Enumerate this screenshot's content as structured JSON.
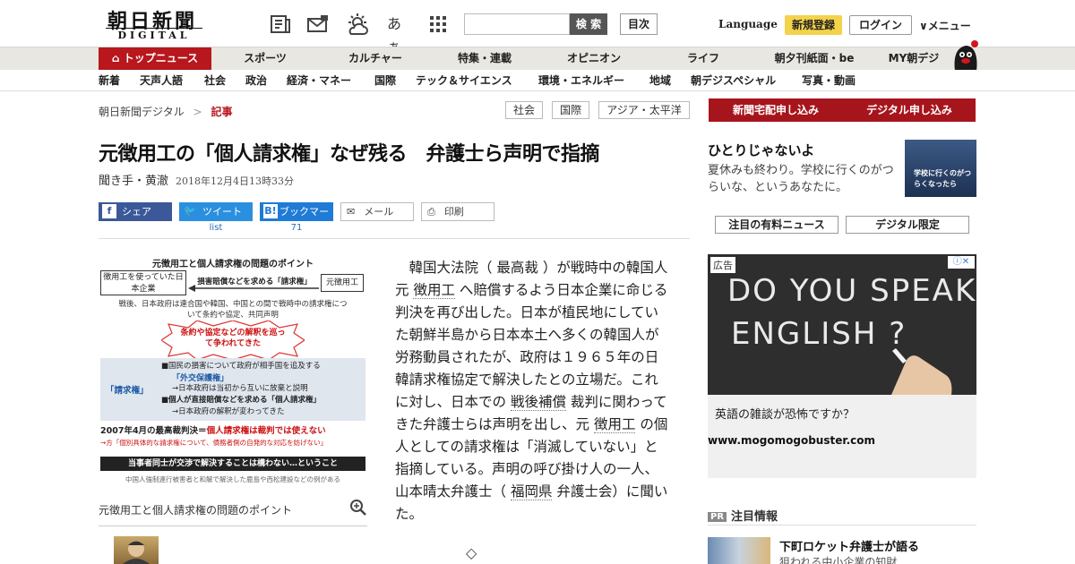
{
  "header": {
    "logo_main": "朝日新聞",
    "logo_sub": "DIGITAL",
    "icons": [
      "paper-icon",
      "mail-icon",
      "weather-icon",
      "font-size-icon",
      "apps-grid-icon"
    ],
    "font_size_label": "あぁ",
    "search_button": "検 索",
    "contents_button": "目次",
    "language": "Language",
    "register": "新規登録",
    "login": "ログイン",
    "menu": "メニュー",
    "brand_color": "#b8171d"
  },
  "global_nav": [
    "トップニュース",
    "スポーツ",
    "カルチャー",
    "特集・連載",
    "オピニオン",
    "ライフ",
    "朝夕刊紙面・be",
    "MY朝デジ"
  ],
  "sub_nav": [
    "新着",
    "天声人語",
    "社会",
    "政治",
    "経済・マネー",
    "国際",
    "テック＆サイエンス",
    "環境・エネルギー",
    "地域",
    "朝デジスペシャル",
    "写真・動画"
  ],
  "breadcrumb": {
    "home": "朝日新聞デジタル",
    "sep": ">",
    "current": "記事"
  },
  "tags": [
    "社会",
    "国際",
    "アジア・太平洋"
  ],
  "cta": {
    "delivery": "新聞宅配申し込み",
    "digital": "デジタル申し込み"
  },
  "article": {
    "title": "元徴用工の「個人請求権」なぜ残る　弁護士ら声明で指摘",
    "author": "聞き手・黄澈",
    "date": "2018年12月4日13時33分",
    "share": {
      "facebook": "シェア",
      "twitter": "ツイート",
      "twitter_count": "list",
      "hatena": "ブックマーク",
      "hatena_count": "71",
      "mail": "メール",
      "print": "印刷"
    },
    "figure_caption": "元徴用工と個人請求権の問題のポイント",
    "paragraphs": [
      [
        {
          "t": "　韓国大法院（ 最高裁 ）が戦時中の韓国人元 "
        },
        {
          "t": "徴用工",
          "u": true
        },
        {
          "t": " へ賠償するよう日本企業に命じる判決を再び出した。日本が植民地にしていた朝鮮半島から日本本土へ多くの韓国人が労務動員されたが、政府は１９６５年の日韓請求権協定で解決したとの立場だ。これに対し、日本での "
        },
        {
          "t": "戦後補償",
          "u": true
        },
        {
          "t": " 裁判に関わってきた弁護士らは声明を出し、元 "
        },
        {
          "t": "徴用工",
          "u": true
        },
        {
          "t": " の個人としての請求権は「消滅していない」と指摘している。声明の呼び掛け人の一人、山本晴太弁護士（ "
        },
        {
          "t": "福岡県",
          "u": true
        },
        {
          "t": " 弁護士会）に聞いた。"
        }
      ]
    ],
    "divider": "◇"
  },
  "infographic": {
    "title": "元徴用工と個人請求権の問題のポイント",
    "left_box": "徴用工を使っていた日本企業",
    "right_box": "元徴用工",
    "arrow_label": "損害賠償などを求める「請求権」",
    "context": "戦後、日本政府は連合国や韓国、中国との間で戦時中の請求権について条約や協定、共同声明",
    "burst": "条約や協定などの解釈を巡って争われてきた",
    "side_label": "「請求権」",
    "item1": "■国民の損害について政府が相手国を追及する",
    "item1_key": "「外交保護権」",
    "item1_res": "→日本政府は当初から互いに放棄と説明",
    "item2": "■個人が直接賠償などを求める「個人請求権」",
    "item2_res": "→日本政府の解釈が変わってきた",
    "ruling_a": "2007年4月の最高裁判決＝",
    "ruling_b": "個人請求権は裁判では使えない",
    "ruling_note": "→方「個別具体的な請求権について、債務者側の自発的な対応を妨げない」",
    "bottom_bar": "当事者同士が交渉で解決することは構わない…ということ",
    "footnote": "中国人強制連行被害者と和解で解決した鹿島や西松建設などの例がある"
  },
  "sidebar": {
    "feature_title": "ひとりじゃないよ",
    "feature_desc": "夏休みも終わり。学校に行くのがつらいな、というあなたに。",
    "feature_img_text": "学校に行くのがつらくなったら",
    "tab1": "注目の有料ニュース",
    "tab2": "デジタル限定",
    "ad_label": "広告",
    "ad_close": "ⓘ✕",
    "ad_board_line1": "DO YOU SPEAK",
    "ad_board_line2": "ENGLISH ?",
    "ad_text": "英語の雑談が恐怖ですか？",
    "ad_url": "www.mogomogobuster.com",
    "pr_badge": "PR",
    "pr_heading": "注目情報",
    "pr_item_title": "下町ロケット弁護士が語る",
    "pr_item_sub": "狙われる中小企業の知財"
  }
}
